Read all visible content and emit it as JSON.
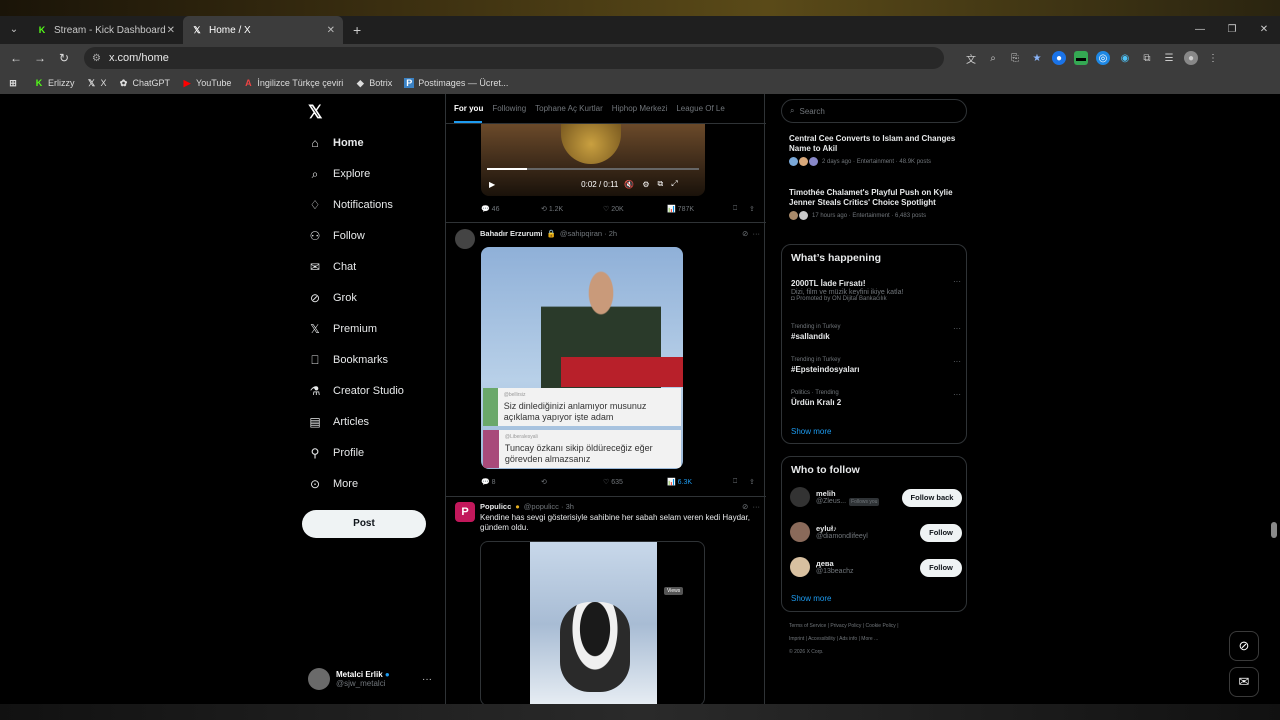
{
  "browser": {
    "tabs": [
      {
        "title": "Stream - Kick Dashboard",
        "icon": "kick-icon",
        "color": "#53fc18"
      },
      {
        "title": "Home / X",
        "icon": "x-logo-icon"
      }
    ],
    "url": "x.com/home",
    "bookmarks": [
      "Erlizzy",
      "X",
      "ChatGPT",
      "YouTube",
      "İngilizce Türkçe çeviri",
      "Botrix",
      "Postimages — Ücret..."
    ]
  },
  "sidebar": {
    "items": [
      {
        "label": "Home",
        "icon": "home-icon"
      },
      {
        "label": "Explore",
        "icon": "search-icon"
      },
      {
        "label": "Notifications",
        "icon": "bell-icon"
      },
      {
        "label": "Follow",
        "icon": "add-person-icon"
      },
      {
        "label": "Chat",
        "icon": "chat-icon"
      },
      {
        "label": "Grok",
        "icon": "grok-icon"
      },
      {
        "label": "Premium",
        "icon": "x-logo-icon"
      },
      {
        "label": "Bookmarks",
        "icon": "bookmark-icon"
      },
      {
        "label": "Creator Studio",
        "icon": "flask-icon"
      },
      {
        "label": "Articles",
        "icon": "article-icon"
      },
      {
        "label": "Profile",
        "icon": "person-icon"
      },
      {
        "label": "More",
        "icon": "more-circle-icon"
      }
    ],
    "post_label": "Post",
    "account": {
      "name": "Metalci Erlik",
      "handle": "@sjw_metalci"
    }
  },
  "feed": {
    "tabs": [
      "For you",
      "Following",
      "Tophane Aç Kurtlar",
      "Hiphop Merkezi",
      "League Of Le"
    ],
    "video1": {
      "time": "0:02 / 0:11",
      "actions": {
        "replies": "46",
        "reposts": "1.2K",
        "likes": "20K",
        "views": "787K"
      }
    },
    "tweet2": {
      "name": "Bahadır Erzurumi",
      "handle": "@sahipqiran",
      "time": "2h",
      "quote1_user": "@bellirsiz",
      "quote1": "Siz dinlediğinizi anlamıyor musunuz açıklama yapıyor işte adam",
      "quote2_user": "@Liberalesyali",
      "quote2": "Tuncay özkanı sikip öldüreceğiz eğer görevden almazsanız",
      "actions": {
        "replies": "8",
        "reposts": "",
        "likes": "635",
        "views": "6.3K"
      },
      "tooltip": "Views"
    },
    "tweet3": {
      "name": "Populicc",
      "handle": "@populicc",
      "time": "3h",
      "text": "Kendine has sevgi gösterisiyle sahibine her sabah selam veren kedi Haydar, gündem oldu."
    }
  },
  "right": {
    "search_placeholder": "Search",
    "news": [
      {
        "title": "Central Cee Converts to Islam and Changes Name to Akil",
        "meta": "2 days ago · Entertainment · 48.9K posts"
      },
      {
        "title": "Timothée Chalamet's Playful Push on Kylie Jenner Steals Critics' Choice Spotlight",
        "meta": "17 hours ago · Entertainment · 6,483 posts"
      }
    ],
    "happening_title": "What’s happening",
    "trends": [
      {
        "context": "",
        "name": "2000TL İade Fırsatı!",
        "desc": "Dizi, film ve müzik keyfini ikiye katla!",
        "promo": "Promoted by ON Dijital Bankacılık"
      },
      {
        "context": "Trending in Turkey",
        "name": "#sallandık",
        "desc": "",
        "promo": ""
      },
      {
        "context": "Trending in Turkey",
        "name": "#Epsteindosyaları",
        "desc": "",
        "promo": ""
      },
      {
        "context": "Politics · Trending",
        "name": "Ürdün Kralı 2",
        "desc": "",
        "promo": ""
      }
    ],
    "show_more": "Show more",
    "wtf_title": "Who to follow",
    "wtf": [
      {
        "name": "melih",
        "handle": "@Zleus...",
        "badge": "Follows you",
        "button": "Follow back"
      },
      {
        "name": "eyluł♪",
        "handle": "@diamondlifeeyl",
        "badge": "",
        "button": "Follow"
      },
      {
        "name": "дева",
        "handle": "@13beachz",
        "badge": "",
        "button": "Follow"
      }
    ],
    "footer": [
      "Terms of Service",
      "Privacy Policy",
      "Cookie Policy",
      "Imprint",
      "Accessibility",
      "Ads info",
      "More ...",
      "© 2026 X Corp."
    ]
  }
}
